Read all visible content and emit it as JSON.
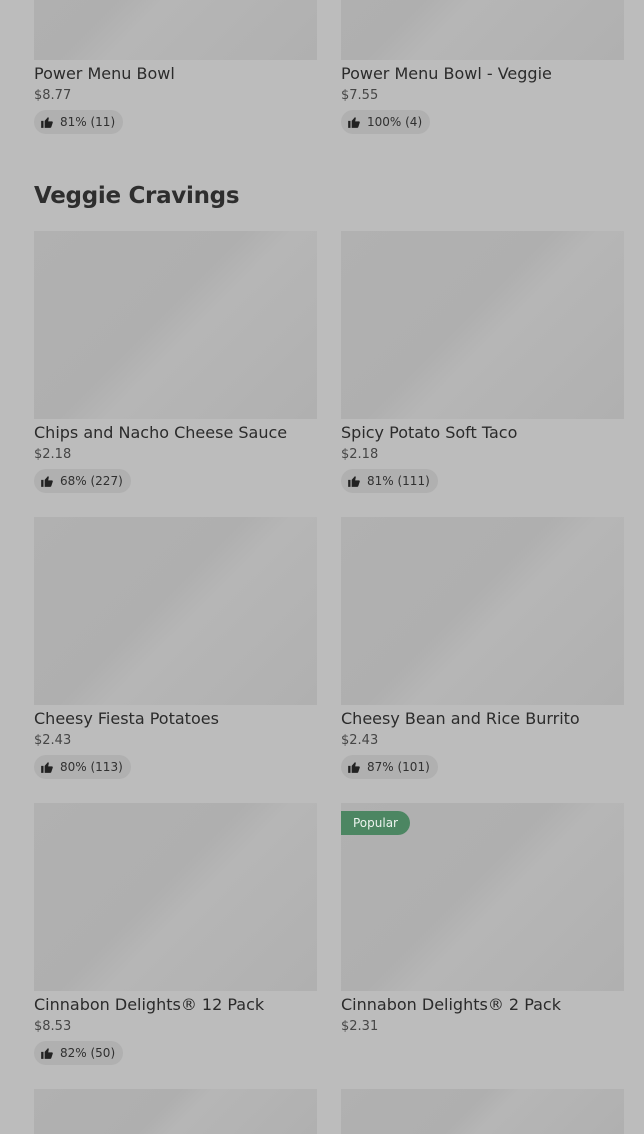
{
  "top_items": [
    {
      "name": "Power Menu Bowl",
      "price": "$8.77",
      "rating": "81% (11)"
    },
    {
      "name": "Power Menu Bowl - Veggie",
      "price": "$7.55",
      "rating": "100% (4)"
    }
  ],
  "section": {
    "title": "Veggie Cravings",
    "items": [
      {
        "name": "Chips and Nacho Cheese Sauce",
        "price": "$2.18",
        "rating": "68% (227)"
      },
      {
        "name": "Spicy Potato Soft Taco",
        "price": "$2.18",
        "rating": "81% (111)"
      },
      {
        "name": "Cheesy Fiesta Potatoes",
        "price": "$2.43",
        "rating": "80% (113)"
      },
      {
        "name": "Cheesy Bean and Rice Burrito",
        "price": "$2.43",
        "rating": "87% (101)"
      },
      {
        "name": "Cinnabon Delights® 12 Pack",
        "price": "$8.53",
        "rating": "82% (50)"
      },
      {
        "name": "Cinnabon Delights® 2 Pack",
        "price": "$2.31",
        "badge": "Popular"
      }
    ]
  },
  "icons": {
    "rating": "thumbs-up-icon"
  }
}
